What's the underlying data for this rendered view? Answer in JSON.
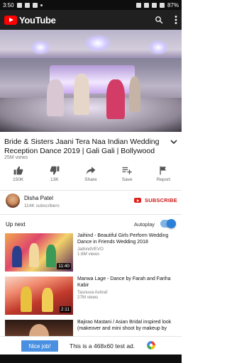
{
  "status_bar": {
    "time": "3:50",
    "battery": "87%"
  },
  "app": {
    "logo_text": "YouTube"
  },
  "video": {
    "title": "Bride & Sisters Jaani Tera Naa Indian Wedding Reception Dance 2019 | Gali Gali | Bollywood",
    "views": "25M views"
  },
  "actions": [
    {
      "label": "150K",
      "icon": "thumbs-up-icon"
    },
    {
      "label": "13K",
      "icon": "thumbs-down-icon"
    },
    {
      "label": "Share",
      "icon": "share-icon"
    },
    {
      "label": "Save",
      "icon": "save-playlist-icon"
    },
    {
      "label": "Report",
      "icon": "flag-icon"
    }
  ],
  "channel": {
    "name": "Disha Patel",
    "subscribers": "114K subscribers",
    "subscribe_label": "SUBSCRIBE"
  },
  "up_next": {
    "label": "Up next",
    "autoplay_label": "Autoplay",
    "autoplay_on": true
  },
  "recommendations": [
    {
      "title": "Jaihind - Beautiful Girls Perform Wedding Dance in Friends Wedding 2018",
      "channel": "JaihindVEVO",
      "views": "1.6M views",
      "duration": "11:40"
    },
    {
      "title": "Manwa Lage - Dance by Farah and Fariha Kabir",
      "channel": "Tasnuva Ashraf",
      "views": "27M views",
      "duration": "2:11"
    },
    {
      "title": "Bajirao Mastani / Asian Bridal inspired look (makeover and mini shoot by makeup by",
      "channel": "",
      "views": "",
      "duration": ""
    }
  ],
  "ad": {
    "button_label": "Nice job!",
    "text": "This is a 468x60 test ad."
  },
  "colors": {
    "accent_red": "#ff0000",
    "subscribe_red": "#cc1a1a",
    "toggle_blue": "#2b7fd6",
    "ad_button": "#4a90e2"
  }
}
